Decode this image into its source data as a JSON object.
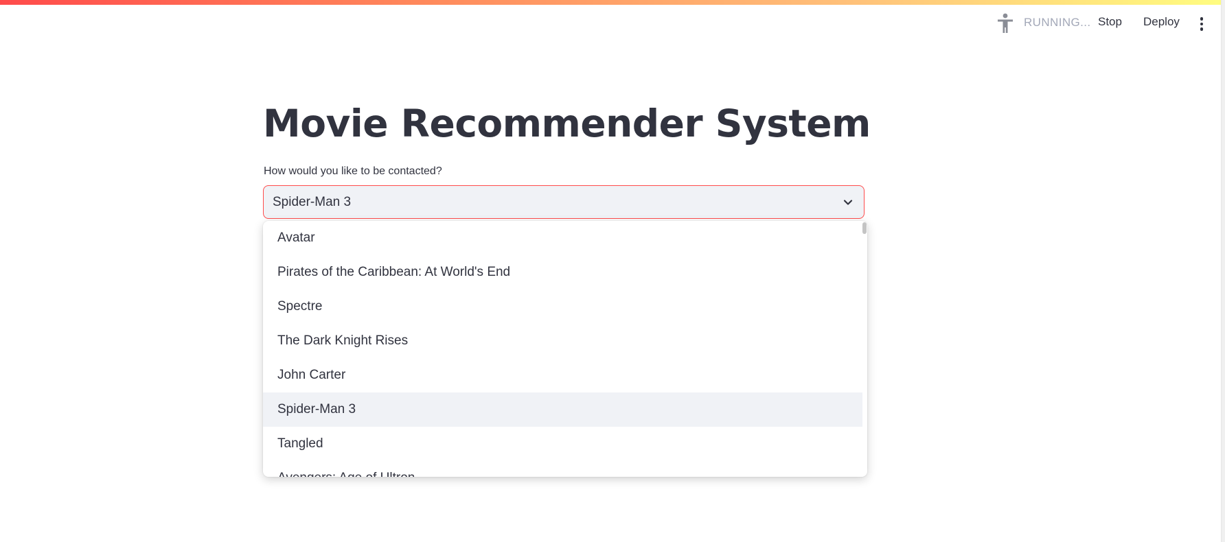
{
  "header": {
    "status_text": "RUNNING...",
    "status_icon": "running-man-icon",
    "stop_label": "Stop",
    "deploy_label": "Deploy",
    "menu_icon": "kebab-menu-icon"
  },
  "main": {
    "title": "Movie Recommender System",
    "select_label": "How would you like to be contacted?",
    "selected_value": "Spider-Man 3",
    "options": [
      "Avatar",
      "Pirates of the Caribbean: At World's End",
      "Spectre",
      "The Dark Knight Rises",
      "John Carter",
      "Spider-Man 3",
      "Tangled",
      "Avengers: Age of Ultron"
    ]
  },
  "colors": {
    "accent": "#ff4b4b",
    "text": "#31333f",
    "muted": "#a3a8b8",
    "input_bg": "#f0f2f6"
  }
}
